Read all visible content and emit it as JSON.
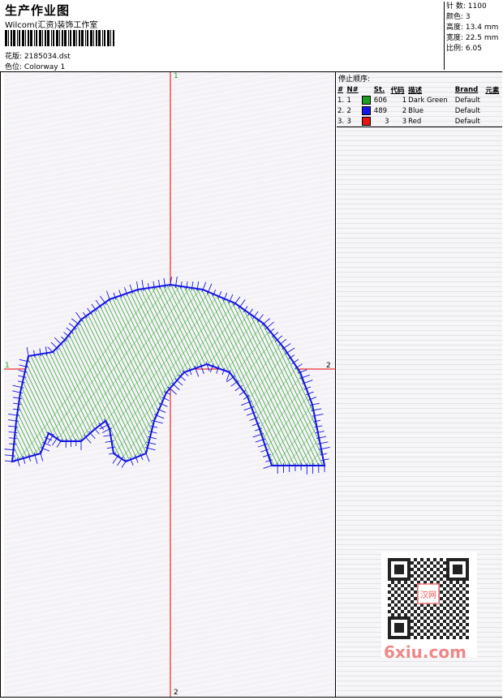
{
  "header": {
    "title": "生产作业图",
    "company": "Wilcom(汇资)装饰工作室",
    "design_label": "花版:",
    "design_file": "2185034.dst",
    "colorway_label": "色位:",
    "colorway": "Colorway 1"
  },
  "stats": [
    {
      "label": "针 数:",
      "value": "1100"
    },
    {
      "label": "颜色:",
      "value": "3"
    },
    {
      "label": "高度:",
      "value": "13.4 mm"
    },
    {
      "label": "宽度:",
      "value": "22.5 mm"
    },
    {
      "label": "比例:",
      "value": "6.05"
    }
  ],
  "stop_sequence": {
    "title": "停止顺序:",
    "columns": [
      "#",
      "N#",
      "St.",
      "代码",
      "描述",
      "Brand",
      "元素"
    ],
    "rows": [
      {
        "num": "1.",
        "n": "1",
        "color": "#1e9e1e",
        "st": "606",
        "code": "1",
        "desc": "Dark Green",
        "brand": "Default"
      },
      {
        "num": "2.",
        "n": "2",
        "color": "#1414e6",
        "st": "489",
        "code": "2",
        "desc": "Blue",
        "brand": "Default"
      },
      {
        "num": "3.",
        "n": "3",
        "color": "#e61414",
        "st": "3",
        "code": "3",
        "desc": "Red",
        "brand": "Default"
      }
    ]
  },
  "axes": {
    "top": "1",
    "bottom": "2",
    "left": "1",
    "right": "2"
  },
  "watermark": "6xiu.com",
  "qr_badge": "汉网"
}
